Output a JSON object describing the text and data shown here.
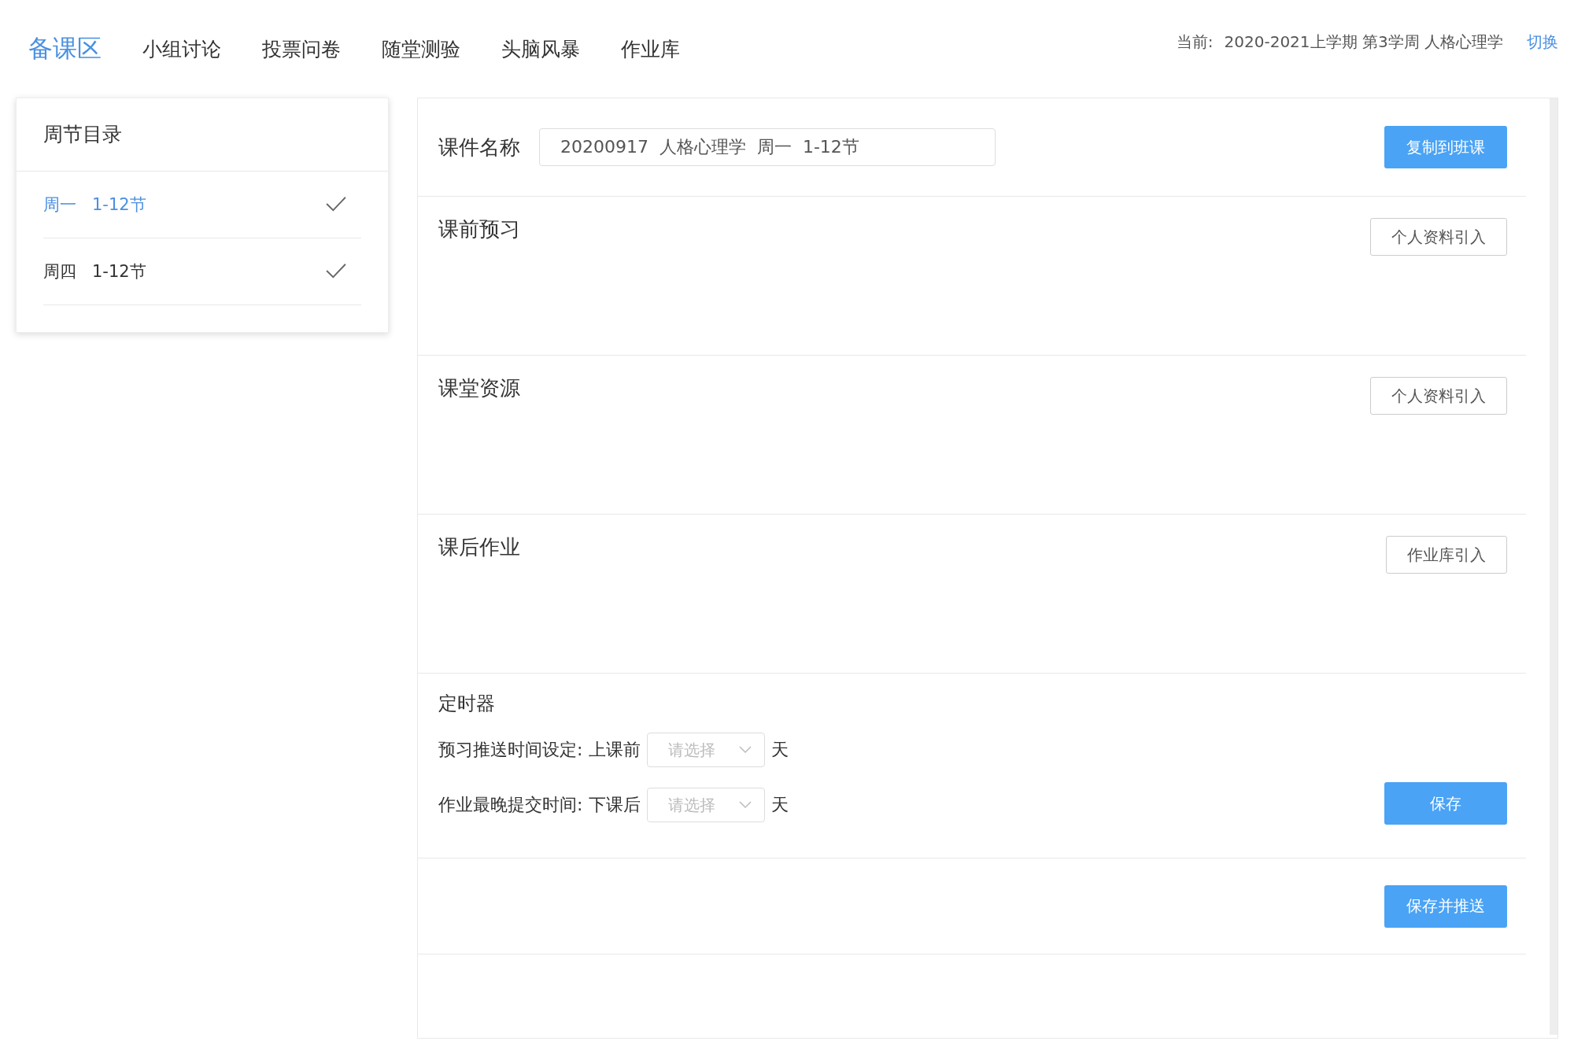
{
  "nav": {
    "tabs": [
      {
        "label": "备课区",
        "selected": true
      },
      {
        "label": "小组讨论",
        "selected": false
      },
      {
        "label": "投票问卷",
        "selected": false
      },
      {
        "label": "随堂测验",
        "selected": false
      },
      {
        "label": "头脑风暴",
        "selected": false
      },
      {
        "label": "作业库",
        "selected": false
      }
    ],
    "current_label": "当前:",
    "current_value": "2020-2021上学期 第3学周 人格心理学",
    "switch_link": "切换"
  },
  "sidebar": {
    "title": "周节目录",
    "items": [
      {
        "day": "周一",
        "periods": "1-12节",
        "selected": true,
        "checked": true
      },
      {
        "day": "周四",
        "periods": "1-12节",
        "selected": false,
        "checked": true
      }
    ]
  },
  "courseware": {
    "label": "课件名称",
    "value": "20200917  人格心理学  周一  1-12节",
    "button": "复制到班课"
  },
  "sections": [
    {
      "title": "课前预习",
      "button": "个人资料引入"
    },
    {
      "title": "课堂资源",
      "button": "个人资料引入"
    },
    {
      "title": "课后作业",
      "button": "作业库引入"
    }
  ],
  "timer": {
    "title": "定时器",
    "rows": [
      {
        "label": "预习推送时间设定:",
        "prefix": "上课前",
        "placeholder": "请选择",
        "unit": "天"
      },
      {
        "label": "作业最晚提交时间:",
        "prefix": "下课后",
        "placeholder": "请选择",
        "unit": "天"
      }
    ],
    "save_button": "保存"
  },
  "push_button": "保存并推送"
}
